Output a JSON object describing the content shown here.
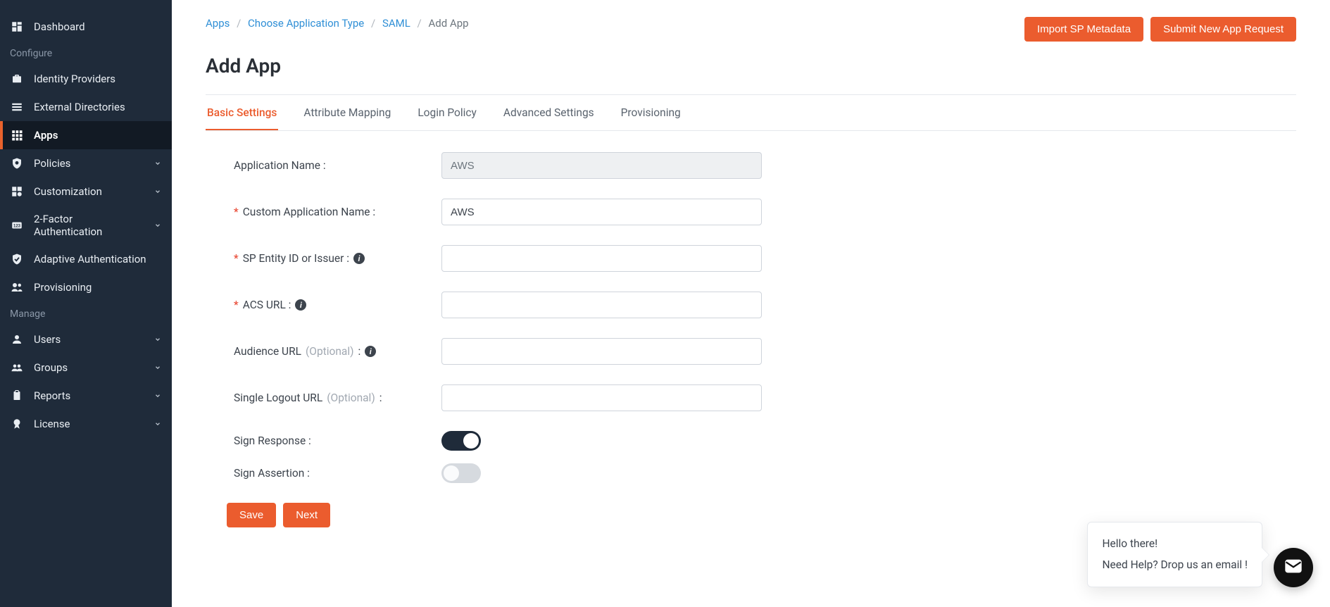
{
  "sidebar": {
    "sectionConfigure": "Configure",
    "sectionManage": "Manage",
    "dashboard": "Dashboard",
    "identityProviders": "Identity Providers",
    "externalDirectories": "External Directories",
    "apps": "Apps",
    "policies": "Policies",
    "customization": "Customization",
    "twoFactor": "2-Factor Authentication",
    "adaptiveAuth": "Adaptive Authentication",
    "provisioning": "Provisioning",
    "users": "Users",
    "groups": "Groups",
    "reports": "Reports",
    "license": "License"
  },
  "breadcrumb": {
    "apps": "Apps",
    "chooseType": "Choose Application Type",
    "saml": "SAML",
    "addApp": "Add App"
  },
  "actions": {
    "importMetadata": "Import SP Metadata",
    "submitNewApp": "Submit New App Request"
  },
  "page": {
    "title": "Add App"
  },
  "tabs": {
    "basic": "Basic Settings",
    "attribute": "Attribute Mapping",
    "login": "Login Policy",
    "advanced": "Advanced Settings",
    "provisioning": "Provisioning"
  },
  "form": {
    "appNameLabel": "Application Name :",
    "appNameValue": "AWS",
    "customAppNameLabel": "Custom Application Name :",
    "customAppNameValue": "AWS",
    "spEntityLabel": "SP Entity ID or Issuer :",
    "spEntityValue": "",
    "acsUrlLabel": "ACS URL :",
    "acsUrlValue": "",
    "audienceLabel": "Audience URL ",
    "audienceOptional": "(Optional)",
    "audienceColon": " :",
    "audienceValue": "",
    "sloLabel": "Single Logout URL ",
    "sloOptional": "(Optional)",
    "sloColon": " :",
    "sloValue": "",
    "signResponseLabel": "Sign Response :",
    "signAssertionLabel": "Sign Assertion :",
    "save": "Save",
    "next": "Next"
  },
  "chat": {
    "line1": "Hello there!",
    "line2": "Need Help? Drop us an email !"
  }
}
